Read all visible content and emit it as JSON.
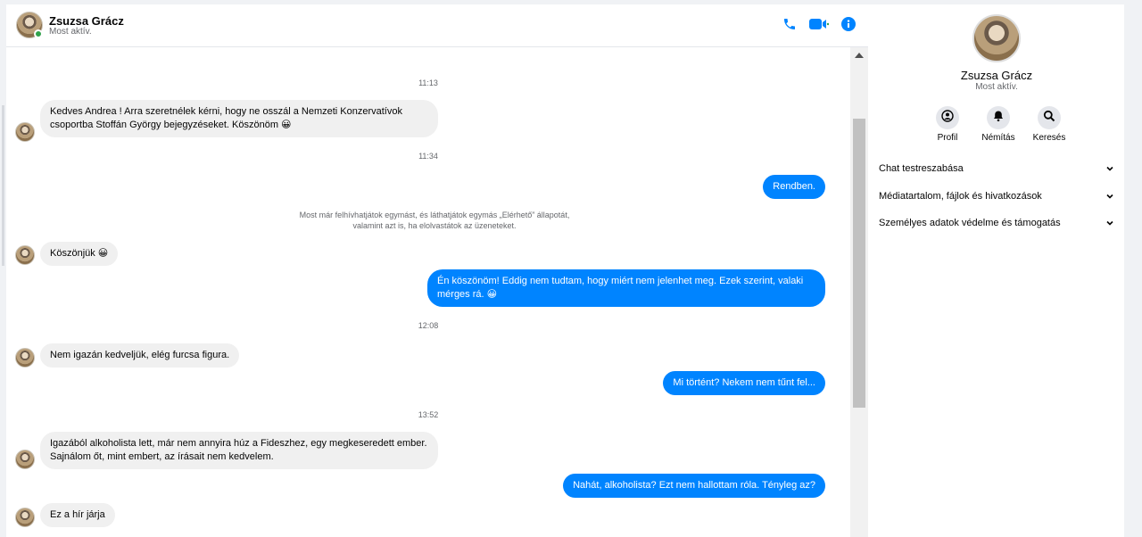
{
  "header": {
    "contact_name": "Zsuzsa Grácz",
    "status": "Most aktív.",
    "icons": [
      "phone-icon",
      "video-call-icon",
      "info-icon"
    ]
  },
  "conversation": {
    "times": [
      "11:13",
      "11:34",
      "12:08",
      "13:52"
    ],
    "system_note_lines": [
      "Most már felhívhatjátok egymást, és láthatjátok egymás „Elérhető” állapotát,",
      "valamint azt is, ha elolvastátok az üzeneteket."
    ],
    "messages": [
      {
        "direction": "incoming",
        "text": "Kedves Andrea ! Arra szeretnélek kérni, hogy ne osszál a Nemzeti Konzervatívok csoportba Stoffán György bejegyzéseket. Köszönöm 😀"
      },
      {
        "direction": "outgoing",
        "text": "Rendben."
      },
      {
        "direction": "incoming",
        "text": "Köszönjük 😀"
      },
      {
        "direction": "outgoing",
        "text": "Én köszönöm! Eddig nem tudtam, hogy miért nem jelenhet meg. Ezek szerint, valaki mérges rá. 😀"
      },
      {
        "direction": "incoming",
        "text": "Nem igazán kedveljük, elég furcsa figura."
      },
      {
        "direction": "outgoing",
        "text": "Mi történt? Nekem nem tűnt fel..."
      },
      {
        "direction": "incoming",
        "text": "Igazából alkoholista lett, már nem annyira húz a Fideszhez, egy megkeseredett ember. Sajnálom őt, mint embert, az írásait nem kedvelem."
      },
      {
        "direction": "outgoing",
        "text": "Nahát, alkoholista? Ezt nem hallottam róla. Tényleg az?"
      },
      {
        "direction": "incoming",
        "text": "Ez a hír járja"
      }
    ]
  },
  "panel": {
    "name": "Zsuzsa Grácz",
    "status": "Most aktív.",
    "actions": [
      {
        "label": "Profil",
        "icon": "profile-icon"
      },
      {
        "label": "Némítás",
        "icon": "bell-icon"
      },
      {
        "label": "Keresés",
        "icon": "search-icon"
      }
    ],
    "sections": [
      "Chat testreszabása",
      "Médiatartalom, fájlok és hivatkozások",
      "Személyes adatok védelme és támogatás"
    ]
  },
  "colors": {
    "accent": "#0084ff",
    "incoming_bubble": "#f0f0f0",
    "online": "#31a24c"
  }
}
